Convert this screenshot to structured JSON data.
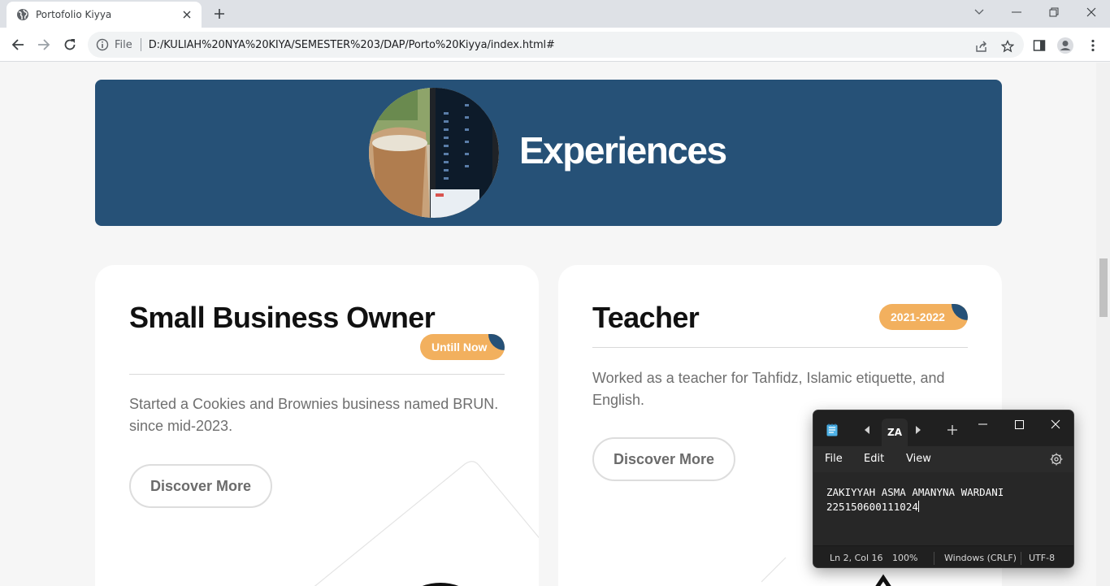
{
  "browser": {
    "tab_title": "Portofolio Kiyya",
    "site_info_label": "File",
    "url": "D:/KULIAH%20NYA%20KIYA/SEMESTER%203/DAP/Porto%20Kiyya/index.html#"
  },
  "hero": {
    "title": "Experiences"
  },
  "cards": [
    {
      "title": "Small Business Owner",
      "badge": "Untill Now",
      "description": "Started a Cookies and Brownies business named BRUN. since mid-2023.",
      "button": "Discover More"
    },
    {
      "title": "Teacher",
      "badge": "2021-2022",
      "description": "Worked as a teacher for Tahfidz, Islamic etiquette, and English.",
      "button": "Discover More"
    }
  ],
  "notepad": {
    "tab_label": "ZA",
    "menu": [
      "File",
      "Edit",
      "View"
    ],
    "lines": [
      "ZAKIYYAH ASMA AMANYNA WARDANI",
      "225150600111024"
    ],
    "status": {
      "position": "Ln 2, Col 16",
      "zoom": "100%",
      "line_ending": "Windows (CRLF)",
      "encoding": "UTF-8"
    }
  },
  "colors": {
    "hero_bg": "#265177",
    "badge_bg": "#f2b05e",
    "page_bg": "#f6f6f6"
  }
}
